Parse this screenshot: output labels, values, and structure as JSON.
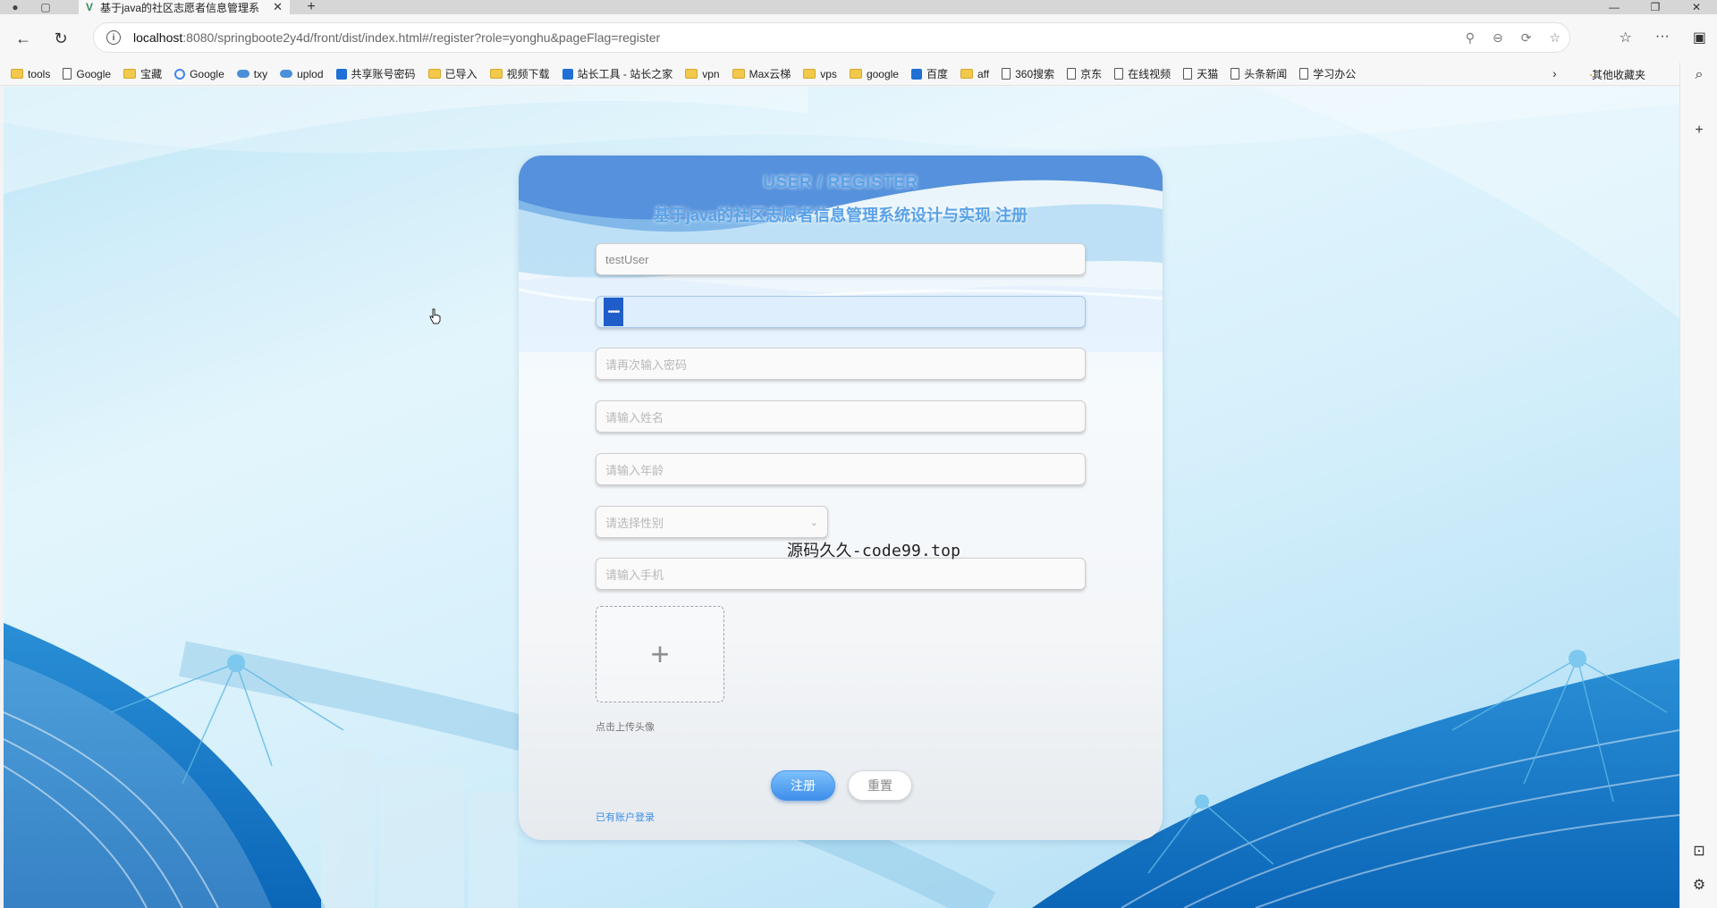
{
  "browser": {
    "tab_title": "基于java的社区志愿者信息管理系",
    "url_host": "localhost",
    "url_rest": ":8080/springboote2y4d/front/dist/index.html#/register?role=yonghu&pageFlag=register",
    "bookmarks": [
      {
        "label": "tools",
        "icon": "folder"
      },
      {
        "label": "Google",
        "icon": "page"
      },
      {
        "label": "宝藏",
        "icon": "folder"
      },
      {
        "label": "Google",
        "icon": "g"
      },
      {
        "label": "txy",
        "icon": "cloud"
      },
      {
        "label": "uplod",
        "icon": "cloud"
      },
      {
        "label": "共享账号密码",
        "icon": "blue"
      },
      {
        "label": "已导入",
        "icon": "folder"
      },
      {
        "label": "视频下载",
        "icon": "folder"
      },
      {
        "label": "站长工具 - 站长之家",
        "icon": "blue"
      },
      {
        "label": "vpn",
        "icon": "folder"
      },
      {
        "label": "Max云梯",
        "icon": "folder"
      },
      {
        "label": "vps",
        "icon": "folder"
      },
      {
        "label": "google",
        "icon": "folder"
      },
      {
        "label": "百度",
        "icon": "blue"
      },
      {
        "label": "aff",
        "icon": "folder"
      },
      {
        "label": "360搜索",
        "icon": "page"
      },
      {
        "label": "京东",
        "icon": "page"
      },
      {
        "label": "在线视频",
        "icon": "page"
      },
      {
        "label": "天猫",
        "icon": "page"
      },
      {
        "label": "头条新闻",
        "icon": "page"
      },
      {
        "label": "学习办公",
        "icon": "page"
      }
    ],
    "other_bookmarks": "其他收藏夹"
  },
  "form": {
    "title": "USER / REGISTER",
    "subtitle": "基于java的社区志愿者信息管理系统设计与实现 注册",
    "username_value": "testUser",
    "password_mask": "•••••",
    "confirm_password_placeholder": "请再次输入密码",
    "name_placeholder": "请输入姓名",
    "age_placeholder": "请输入年龄",
    "gender_placeholder": "请选择性别",
    "phone_placeholder": "请输入手机",
    "upload_label": "点击上传头像",
    "register_button": "注册",
    "reset_button": "重置",
    "login_link": "已有账户登录"
  },
  "watermark": "源码久久-code99.top",
  "colors": {
    "accent": "#3d8eea",
    "title": "#5aa2e6",
    "selection": "#1f5ec8"
  }
}
